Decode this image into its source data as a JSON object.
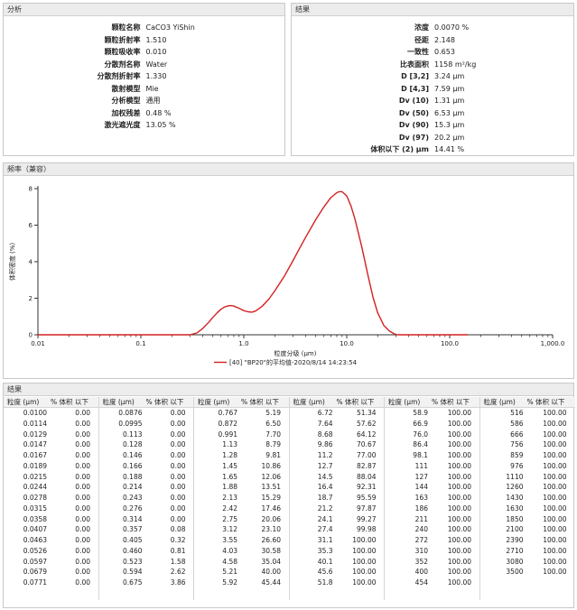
{
  "analysis": {
    "title": "分析",
    "rows": [
      {
        "k": "颗粒名称",
        "v": "CaCO3 YiShin"
      },
      {
        "k": "颗粒折射率",
        "v": "1.510"
      },
      {
        "k": "颗粒吸收率",
        "v": "0.010"
      },
      {
        "k": "分散剂名称",
        "v": "Water"
      },
      {
        "k": "分散剂折射率",
        "v": "1.330"
      },
      {
        "k": "散射模型",
        "v": "Mie"
      },
      {
        "k": "分析模型",
        "v": "通用"
      },
      {
        "k": "加权残差",
        "v": "0.48 %"
      },
      {
        "k": "激光遮光度",
        "v": "13.05 %"
      }
    ]
  },
  "results_top": {
    "title": "结果",
    "rows": [
      {
        "k": "浓度",
        "v": "0.0070 %"
      },
      {
        "k": "径距",
        "v": "2.148"
      },
      {
        "k": "一致性",
        "v": "0.653"
      },
      {
        "k": "比表面积",
        "v": "1158 m²/kg"
      },
      {
        "k": "D [3,2]",
        "v": "3.24 μm"
      },
      {
        "k": "D [4,3]",
        "v": "7.59 μm"
      },
      {
        "k": "Dv (10)",
        "v": "1.31 μm"
      },
      {
        "k": "Dv (50)",
        "v": "6.53 μm"
      },
      {
        "k": "Dv (90)",
        "v": "15.3 μm"
      },
      {
        "k": "Dv (97)",
        "v": "20.2 μm"
      },
      {
        "k": "体积以下 (2) μm",
        "v": "14.41 %"
      }
    ]
  },
  "freq_panel": {
    "title": "频率（兼容）"
  },
  "chart_data": {
    "type": "line",
    "xscale": "log",
    "xlim": [
      0.01,
      1000
    ],
    "ylim": [
      0,
      8
    ],
    "x_ticks": [
      "0.01",
      "0.1",
      "1.0",
      "10.0",
      "100.0",
      "1,000.0"
    ],
    "y_ticks": [
      "0",
      "2",
      "4",
      "6",
      "8"
    ],
    "xlabel": "粒度分级 (μm)",
    "ylabel": "体积密度 (%)",
    "series": [
      {
        "name": "[40] \"BP20\"的平均值-2020/8/14 14:23:54",
        "color": "#d42020",
        "x": [
          0.01,
          0.3,
          0.35,
          0.4,
          0.45,
          0.5,
          0.55,
          0.6,
          0.65,
          0.7,
          0.75,
          0.8,
          0.9,
          1.0,
          1.1,
          1.2,
          1.3,
          1.5,
          1.75,
          2.0,
          2.5,
          3.0,
          3.5,
          4.0,
          5.0,
          6.0,
          7.0,
          8.0,
          8.5,
          9.0,
          10.0,
          11.0,
          12.0,
          14.0,
          16.0,
          18.0,
          20.0,
          23.0,
          26.0,
          29.0,
          31.0,
          35.0,
          150.0
        ],
        "y": [
          0,
          0,
          0.1,
          0.35,
          0.65,
          0.95,
          1.2,
          1.4,
          1.52,
          1.58,
          1.6,
          1.57,
          1.45,
          1.32,
          1.26,
          1.24,
          1.3,
          1.55,
          1.95,
          2.4,
          3.25,
          4.05,
          4.75,
          5.35,
          6.3,
          7.0,
          7.5,
          7.78,
          7.83,
          7.83,
          7.6,
          7.05,
          6.35,
          4.8,
          3.3,
          2.05,
          1.2,
          0.5,
          0.2,
          0.05,
          0,
          0,
          0
        ]
      }
    ]
  },
  "results_table": {
    "title": "结果",
    "headers": {
      "size": "粒度 (μm)",
      "vol": "% 体积 以下"
    },
    "columns": [
      [
        [
          "0.0100",
          "0.00"
        ],
        [
          "0.0114",
          "0.00"
        ],
        [
          "0.0129",
          "0.00"
        ],
        [
          "0.0147",
          "0.00"
        ],
        [
          "0.0167",
          "0.00"
        ],
        [
          "0.0189",
          "0.00"
        ],
        [
          "0.0215",
          "0.00"
        ],
        [
          "0.0244",
          "0.00"
        ],
        [
          "0.0278",
          "0.00"
        ],
        [
          "0.0315",
          "0.00"
        ],
        [
          "0.0358",
          "0.00"
        ],
        [
          "0.0407",
          "0.00"
        ],
        [
          "0.0463",
          "0.00"
        ],
        [
          "0.0526",
          "0.00"
        ],
        [
          "0.0597",
          "0.00"
        ],
        [
          "0.0679",
          "0.00"
        ],
        [
          "0.0771",
          "0.00"
        ]
      ],
      [
        [
          "0.0876",
          "0.00"
        ],
        [
          "0.0995",
          "0.00"
        ],
        [
          "0.113",
          "0.00"
        ],
        [
          "0.128",
          "0.00"
        ],
        [
          "0.146",
          "0.00"
        ],
        [
          "0.166",
          "0.00"
        ],
        [
          "0.188",
          "0.00"
        ],
        [
          "0.214",
          "0.00"
        ],
        [
          "0.243",
          "0.00"
        ],
        [
          "0.276",
          "0.00"
        ],
        [
          "0.314",
          "0.00"
        ],
        [
          "0.357",
          "0.08"
        ],
        [
          "0.405",
          "0.32"
        ],
        [
          "0.460",
          "0.81"
        ],
        [
          "0.523",
          "1.58"
        ],
        [
          "0.594",
          "2.62"
        ],
        [
          "0.675",
          "3.86"
        ]
      ],
      [
        [
          "0.767",
          "5.19"
        ],
        [
          "0.872",
          "6.50"
        ],
        [
          "0.991",
          "7.70"
        ],
        [
          "1.13",
          "8.79"
        ],
        [
          "1.28",
          "9.81"
        ],
        [
          "1.45",
          "10.86"
        ],
        [
          "1.65",
          "12.06"
        ],
        [
          "1.88",
          "13.51"
        ],
        [
          "2.13",
          "15.29"
        ],
        [
          "2.42",
          "17.46"
        ],
        [
          "2.75",
          "20.06"
        ],
        [
          "3.12",
          "23.10"
        ],
        [
          "3.55",
          "26.60"
        ],
        [
          "4.03",
          "30.58"
        ],
        [
          "4.58",
          "35.04"
        ],
        [
          "5.21",
          "40.00"
        ],
        [
          "5.92",
          "45.44"
        ]
      ],
      [
        [
          "6.72",
          "51.34"
        ],
        [
          "7.64",
          "57.62"
        ],
        [
          "8.68",
          "64.12"
        ],
        [
          "9.86",
          "70.67"
        ],
        [
          "11.2",
          "77.00"
        ],
        [
          "12.7",
          "82.87"
        ],
        [
          "14.5",
          "88.04"
        ],
        [
          "16.4",
          "92.31"
        ],
        [
          "18.7",
          "95.59"
        ],
        [
          "21.2",
          "97.87"
        ],
        [
          "24.1",
          "99.27"
        ],
        [
          "27.4",
          "99.98"
        ],
        [
          "31.1",
          "100.00"
        ],
        [
          "35.3",
          "100.00"
        ],
        [
          "40.1",
          "100.00"
        ],
        [
          "45.6",
          "100.00"
        ],
        [
          "51.8",
          "100.00"
        ]
      ],
      [
        [
          "58.9",
          "100.00"
        ],
        [
          "66.9",
          "100.00"
        ],
        [
          "76.0",
          "100.00"
        ],
        [
          "86.4",
          "100.00"
        ],
        [
          "98.1",
          "100.00"
        ],
        [
          "111",
          "100.00"
        ],
        [
          "127",
          "100.00"
        ],
        [
          "144",
          "100.00"
        ],
        [
          "163",
          "100.00"
        ],
        [
          "186",
          "100.00"
        ],
        [
          "211",
          "100.00"
        ],
        [
          "240",
          "100.00"
        ],
        [
          "272",
          "100.00"
        ],
        [
          "310",
          "100.00"
        ],
        [
          "352",
          "100.00"
        ],
        [
          "400",
          "100.00"
        ],
        [
          "454",
          "100.00"
        ]
      ],
      [
        [
          "516",
          "100.00"
        ],
        [
          "586",
          "100.00"
        ],
        [
          "666",
          "100.00"
        ],
        [
          "756",
          "100.00"
        ],
        [
          "859",
          "100.00"
        ],
        [
          "976",
          "100.00"
        ],
        [
          "1110",
          "100.00"
        ],
        [
          "1260",
          "100.00"
        ],
        [
          "1430",
          "100.00"
        ],
        [
          "1630",
          "100.00"
        ],
        [
          "1850",
          "100.00"
        ],
        [
          "2100",
          "100.00"
        ],
        [
          "2390",
          "100.00"
        ],
        [
          "2710",
          "100.00"
        ],
        [
          "3080",
          "100.00"
        ],
        [
          "3500",
          "100.00"
        ]
      ]
    ]
  }
}
